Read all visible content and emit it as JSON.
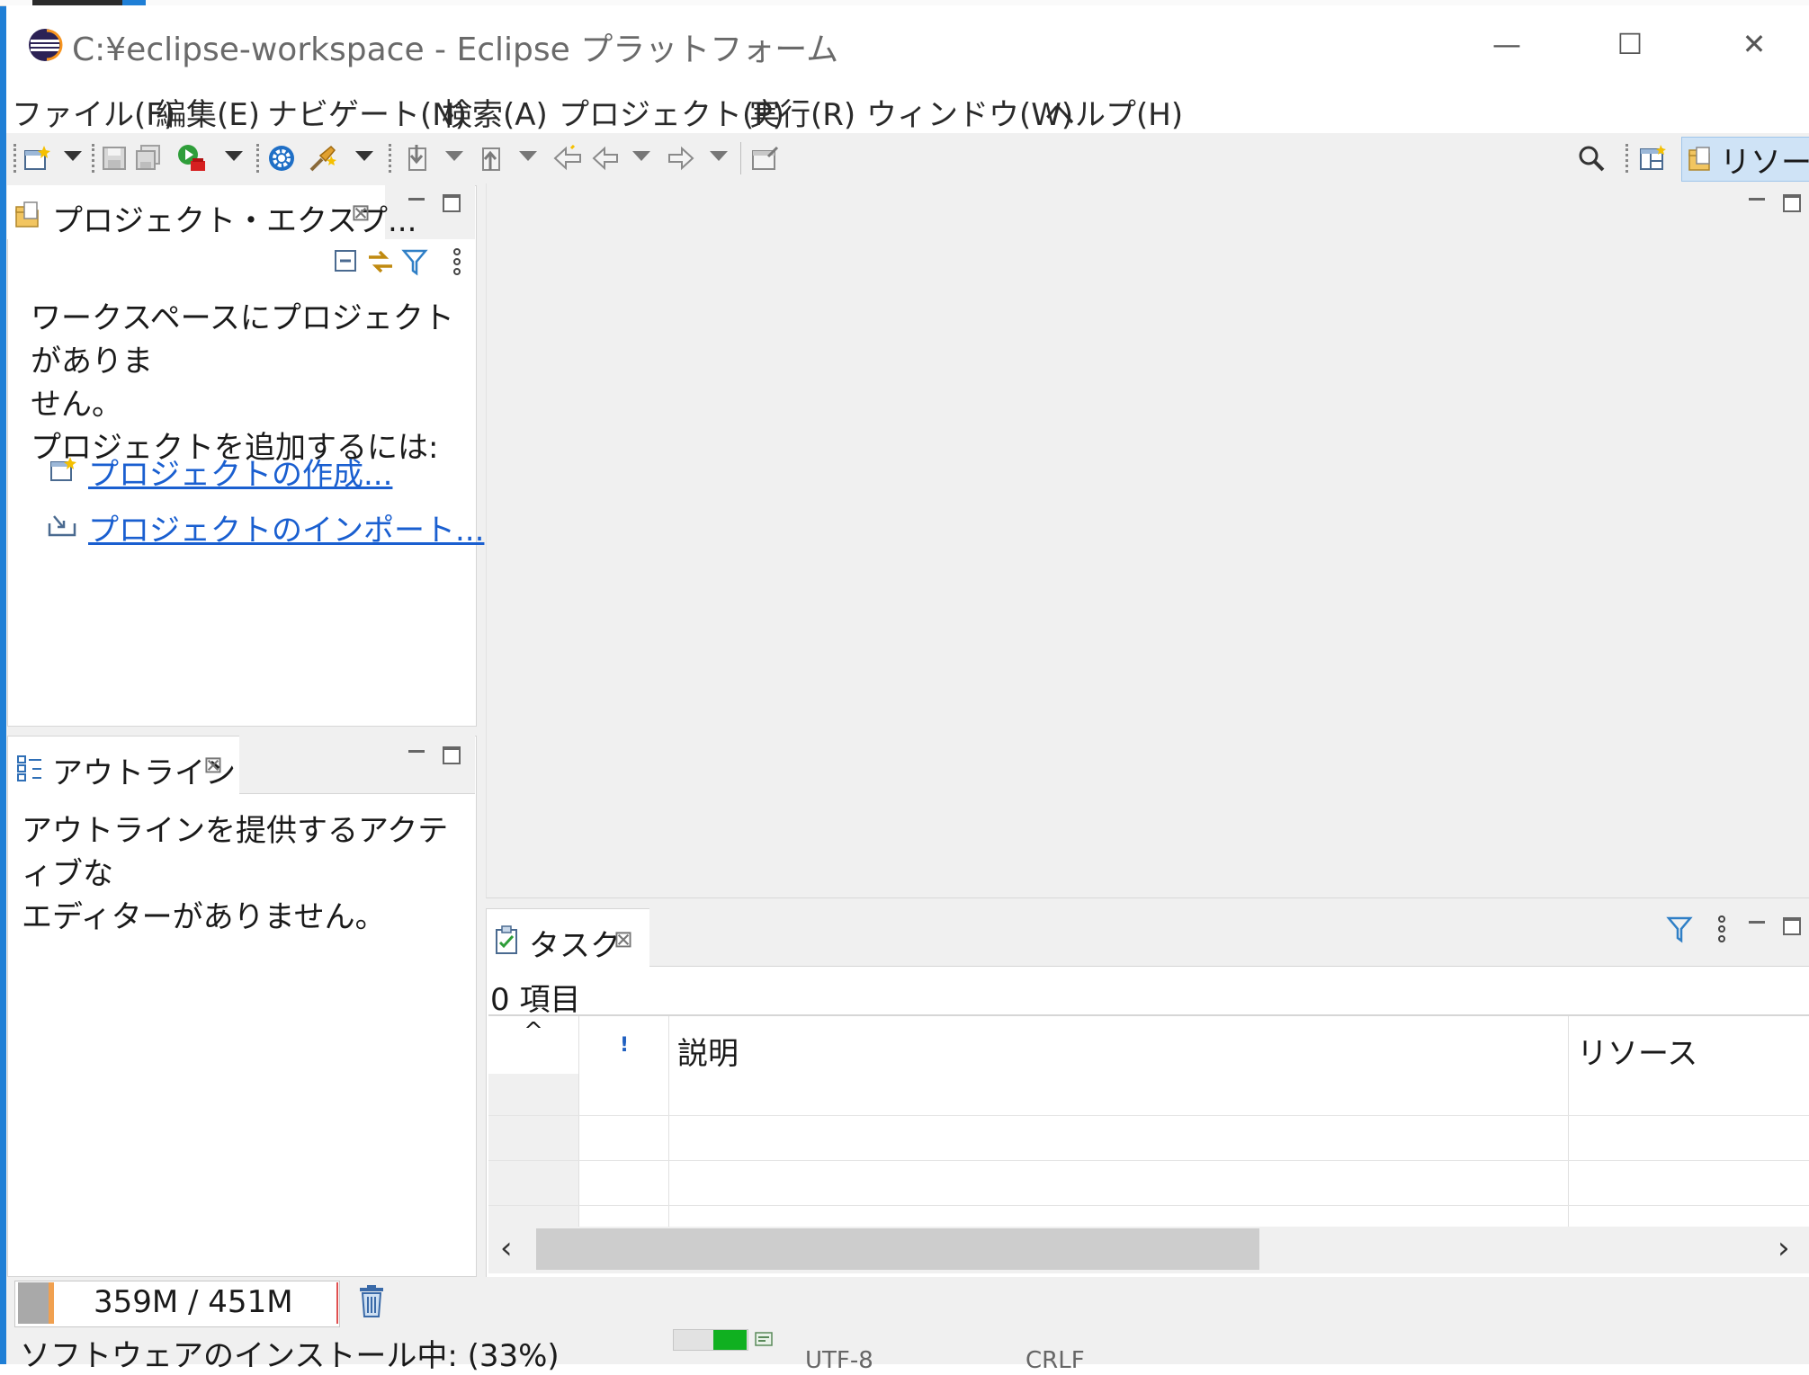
{
  "window": {
    "title": "C:¥eclipse-workspace - Eclipse プラットフォーム",
    "minimize": "—",
    "maximize": "☐",
    "close": "✕"
  },
  "menu": {
    "items": [
      "ファイル(F)",
      "編集(E)",
      "ナビゲート(N)",
      "検索(A)",
      "プロジェクト(P)",
      "実行(R)",
      "ウィンドウ(W)",
      "ヘルプ(H)"
    ]
  },
  "toolbar": {
    "perspective_label": "リソース"
  },
  "project_explorer": {
    "title": "プロジェクト・エクスプ...",
    "message_line1": "ワークスペースにプロジェクトがありま",
    "message_line2": "せん。",
    "message_line3": "プロジェクトを追加するには:",
    "link_create": "プロジェクトの作成...",
    "link_import": "プロジェクトのインポート..."
  },
  "outline": {
    "title": "アウトライン",
    "message_line1": "アウトラインを提供するアクティブな",
    "message_line2": "エディターがありません。"
  },
  "tasks": {
    "title": "タスク",
    "count": "0 項目",
    "columns": {
      "sort": "^",
      "priority": "!",
      "description": "説明",
      "resource": "リソース"
    }
  },
  "status": {
    "heap": "359M / 451M",
    "install_progress": "ソフトウェアのインストール中: (33%)",
    "progress_fraction": 0.33,
    "right1": "UTF-8",
    "right2": "CRLF"
  },
  "colors": {
    "accent": "#1f7fd6",
    "link": "#1a5fd0",
    "progress": "#10b020"
  }
}
